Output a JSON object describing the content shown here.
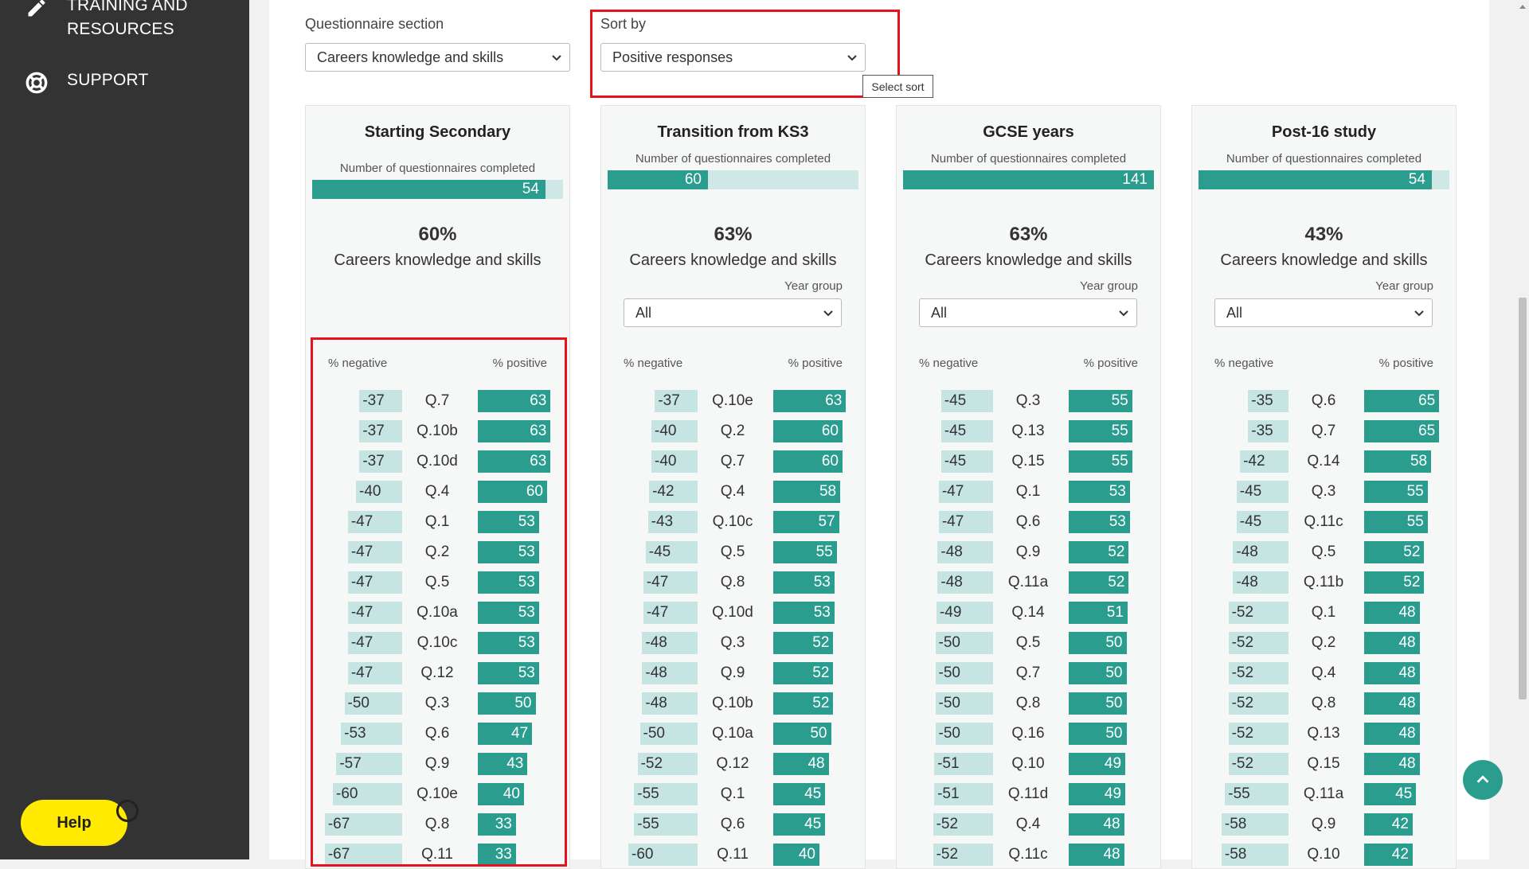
{
  "sidebar": {
    "items": [
      {
        "label_line1": "TRAINING AND",
        "label_line2": "RESOURCES",
        "icon": "pencil-icon"
      },
      {
        "label": "SUPPORT",
        "icon": "lifebuoy-icon"
      }
    ],
    "help_label": "Help"
  },
  "controls": {
    "section_label": "Questionnaire section",
    "section_value": "Careers knowledge and skills",
    "sort_label": "Sort by",
    "sort_value": "Positive responses",
    "sort_tooltip": "Select sort"
  },
  "colors": {
    "positive": "#2a9d8f",
    "negative": "#c6e5e2",
    "highlight": "#e3141c",
    "help": "#ffea00"
  },
  "cards": [
    {
      "title": "Starting Secondary",
      "count_label": "Number of questionnaires completed",
      "count": "54",
      "count_fraction": 0.93,
      "percent": "60%",
      "section": "Careers knowledge and skills",
      "year_group_label": null,
      "year_group_value": null,
      "neg_header": "% negative",
      "pos_header": "% positive",
      "rows": [
        {
          "neg": -37,
          "q": "Q.7",
          "pos": 63
        },
        {
          "neg": -37,
          "q": "Q.10b",
          "pos": 63
        },
        {
          "neg": -37,
          "q": "Q.10d",
          "pos": 63
        },
        {
          "neg": -40,
          "q": "Q.4",
          "pos": 60
        },
        {
          "neg": -47,
          "q": "Q.1",
          "pos": 53
        },
        {
          "neg": -47,
          "q": "Q.2",
          "pos": 53
        },
        {
          "neg": -47,
          "q": "Q.5",
          "pos": 53
        },
        {
          "neg": -47,
          "q": "Q.10a",
          "pos": 53
        },
        {
          "neg": -47,
          "q": "Q.10c",
          "pos": 53
        },
        {
          "neg": -47,
          "q": "Q.12",
          "pos": 53
        },
        {
          "neg": -50,
          "q": "Q.3",
          "pos": 50
        },
        {
          "neg": -53,
          "q": "Q.6",
          "pos": 47
        },
        {
          "neg": -57,
          "q": "Q.9",
          "pos": 43
        },
        {
          "neg": -60,
          "q": "Q.10e",
          "pos": 40
        },
        {
          "neg": -67,
          "q": "Q.8",
          "pos": 33
        },
        {
          "neg": -67,
          "q": "Q.11",
          "pos": 33
        }
      ]
    },
    {
      "title": "Transition from KS3",
      "count_label": "Number of questionnaires completed",
      "count": "60",
      "count_fraction": 0.4,
      "percent": "63%",
      "section": "Careers knowledge and skills",
      "year_group_label": "Year group",
      "year_group_value": "All",
      "neg_header": "% negative",
      "pos_header": "% positive",
      "rows": [
        {
          "neg": -37,
          "q": "Q.10e",
          "pos": 63
        },
        {
          "neg": -40,
          "q": "Q.2",
          "pos": 60
        },
        {
          "neg": -40,
          "q": "Q.7",
          "pos": 60
        },
        {
          "neg": -42,
          "q": "Q.4",
          "pos": 58
        },
        {
          "neg": -43,
          "q": "Q.10c",
          "pos": 57
        },
        {
          "neg": -45,
          "q": "Q.5",
          "pos": 55
        },
        {
          "neg": -47,
          "q": "Q.8",
          "pos": 53
        },
        {
          "neg": -47,
          "q": "Q.10d",
          "pos": 53
        },
        {
          "neg": -48,
          "q": "Q.3",
          "pos": 52
        },
        {
          "neg": -48,
          "q": "Q.9",
          "pos": 52
        },
        {
          "neg": -48,
          "q": "Q.10b",
          "pos": 52
        },
        {
          "neg": -50,
          "q": "Q.10a",
          "pos": 50
        },
        {
          "neg": -52,
          "q": "Q.12",
          "pos": 48
        },
        {
          "neg": -55,
          "q": "Q.1",
          "pos": 45
        },
        {
          "neg": -55,
          "q": "Q.6",
          "pos": 45
        },
        {
          "neg": -60,
          "q": "Q.11",
          "pos": 40
        }
      ]
    },
    {
      "title": "GCSE years",
      "count_label": "Number of questionnaires completed",
      "count": "141",
      "count_fraction": 1.0,
      "percent": "63%",
      "section": "Careers knowledge and skills",
      "year_group_label": "Year group",
      "year_group_value": "All",
      "neg_header": "% negative",
      "pos_header": "% positive",
      "rows": [
        {
          "neg": -45,
          "q": "Q.3",
          "pos": 55
        },
        {
          "neg": -45,
          "q": "Q.13",
          "pos": 55
        },
        {
          "neg": -45,
          "q": "Q.15",
          "pos": 55
        },
        {
          "neg": -47,
          "q": "Q.1",
          "pos": 53
        },
        {
          "neg": -47,
          "q": "Q.6",
          "pos": 53
        },
        {
          "neg": -48,
          "q": "Q.9",
          "pos": 52
        },
        {
          "neg": -48,
          "q": "Q.11a",
          "pos": 52
        },
        {
          "neg": -49,
          "q": "Q.14",
          "pos": 51
        },
        {
          "neg": -50,
          "q": "Q.5",
          "pos": 50
        },
        {
          "neg": -50,
          "q": "Q.7",
          "pos": 50
        },
        {
          "neg": -50,
          "q": "Q.8",
          "pos": 50
        },
        {
          "neg": -50,
          "q": "Q.16",
          "pos": 50
        },
        {
          "neg": -51,
          "q": "Q.10",
          "pos": 49
        },
        {
          "neg": -51,
          "q": "Q.11d",
          "pos": 49
        },
        {
          "neg": -52,
          "q": "Q.4",
          "pos": 48
        },
        {
          "neg": -52,
          "q": "Q.11c",
          "pos": 48
        }
      ]
    },
    {
      "title": "Post-16 study",
      "count_label": "Number of questionnaires completed",
      "count": "54",
      "count_fraction": 0.93,
      "percent": "43%",
      "section": "Careers knowledge and skills",
      "year_group_label": "Year group",
      "year_group_value": "All",
      "neg_header": "% negative",
      "pos_header": "% positive",
      "rows": [
        {
          "neg": -35,
          "q": "Q.6",
          "pos": 65
        },
        {
          "neg": -35,
          "q": "Q.7",
          "pos": 65
        },
        {
          "neg": -42,
          "q": "Q.14",
          "pos": 58
        },
        {
          "neg": -45,
          "q": "Q.3",
          "pos": 55
        },
        {
          "neg": -45,
          "q": "Q.11c",
          "pos": 55
        },
        {
          "neg": -48,
          "q": "Q.5",
          "pos": 52
        },
        {
          "neg": -48,
          "q": "Q.11b",
          "pos": 52
        },
        {
          "neg": -52,
          "q": "Q.1",
          "pos": 48
        },
        {
          "neg": -52,
          "q": "Q.2",
          "pos": 48
        },
        {
          "neg": -52,
          "q": "Q.4",
          "pos": 48
        },
        {
          "neg": -52,
          "q": "Q.8",
          "pos": 48
        },
        {
          "neg": -52,
          "q": "Q.13",
          "pos": 48
        },
        {
          "neg": -52,
          "q": "Q.15",
          "pos": 48
        },
        {
          "neg": -55,
          "q": "Q.11a",
          "pos": 45
        },
        {
          "neg": -58,
          "q": "Q.9",
          "pos": 42
        },
        {
          "neg": -58,
          "q": "Q.10",
          "pos": 42
        }
      ]
    }
  ]
}
